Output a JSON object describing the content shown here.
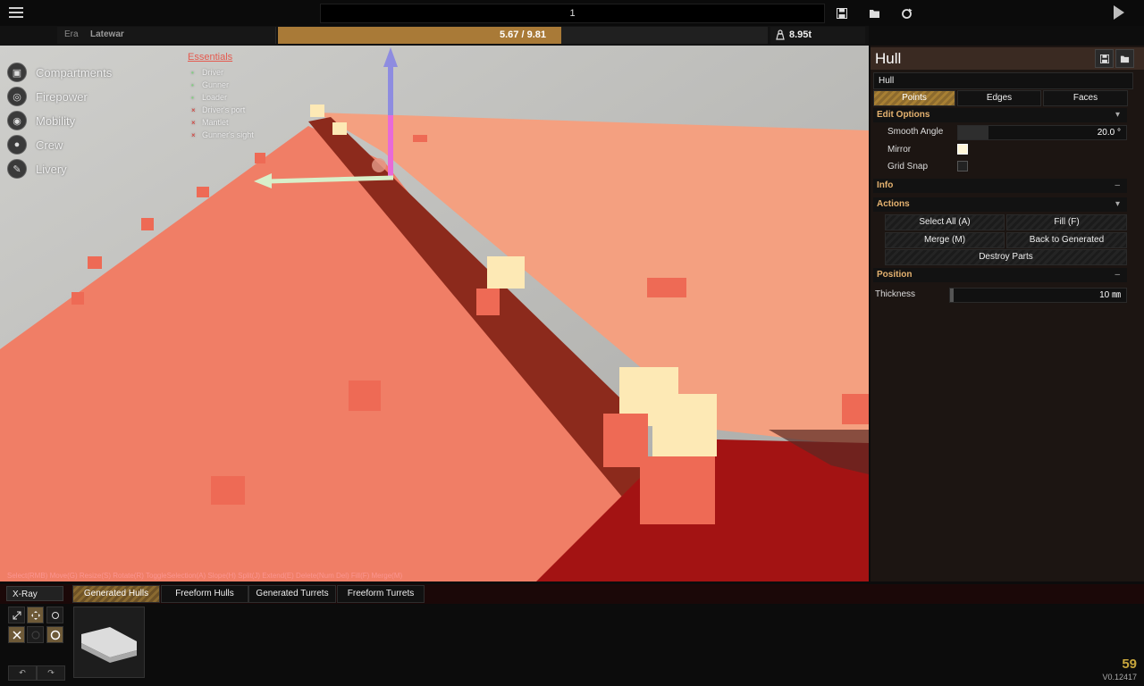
{
  "top": {
    "vehicle_name": "1",
    "save_icon": "save-icon",
    "load_icon": "folder-open-icon",
    "refresh_icon": "refresh-icon",
    "play_icon": "play-icon"
  },
  "stats": {
    "era_label": "Era",
    "era_value": "Latewar",
    "cost_text": "5.67 / 9.81",
    "cost_fraction": 0.578,
    "weight_text": "8.95t",
    "accent_color": "#a97a37"
  },
  "left_menu": [
    {
      "label": "Compartments",
      "icon": "cube-icon"
    },
    {
      "label": "Firepower",
      "icon": "target-icon"
    },
    {
      "label": "Mobility",
      "icon": "wheel-icon"
    },
    {
      "label": "Crew",
      "icon": "person-icon"
    },
    {
      "label": "Livery",
      "icon": "brush-icon"
    }
  ],
  "essentials": {
    "title": "Essentials",
    "items": [
      {
        "label": "Driver",
        "status": "ok",
        "mark": "•"
      },
      {
        "label": "Gunner",
        "status": "ok",
        "mark": "•"
      },
      {
        "label": "Loader",
        "status": "ok",
        "mark": "•"
      },
      {
        "label": "Driver's port",
        "status": "missing",
        "mark": "×"
      },
      {
        "label": "Mantlet",
        "status": "missing",
        "mark": "×"
      },
      {
        "label": "Gunner's sight",
        "status": "missing",
        "mark": "×"
      }
    ]
  },
  "shortcuts": "Select(RMB) Move(G) Resize(S) Rotate(R) ToggleSelection(A) Slope(H) Split(J) Extend(E) Delete(Num Del) Fill(F) Merge(M)",
  "panel": {
    "title": "Hull",
    "name_value": "Hull",
    "modes": [
      "Points",
      "Edges",
      "Faces"
    ],
    "active_mode": 0,
    "edit_options": {
      "title": "Edit Options",
      "smooth_angle_label": "Smooth Angle",
      "smooth_angle_value": "20.0 °",
      "smooth_angle_fraction": 0.18,
      "mirror_label": "Mirror",
      "mirror_on": true,
      "grid_snap_label": "Grid Snap",
      "grid_snap_on": false
    },
    "info_title": "Info",
    "actions": {
      "title": "Actions",
      "select_all": "Select All (A)",
      "fill": "Fill (F)",
      "merge": "Merge (M)",
      "back_to_generated": "Back to Generated",
      "destroy_parts": "Destroy Parts"
    },
    "position": {
      "title": "Position",
      "thickness_label": "Thickness",
      "thickness_value": "10 ㎜",
      "thickness_fraction": 0.02
    }
  },
  "bottom": {
    "xray": "X-Ray",
    "tabs": [
      "Generated Hulls",
      "Freeform Hulls",
      "Generated Turrets",
      "Freeform Turrets"
    ],
    "active_tab": 0,
    "tools": [
      "scale-icon",
      "move-icon",
      "rotate-icon",
      "mirror-icon",
      "center-icon",
      "reset-icon"
    ],
    "undo_icon": "undo-icon",
    "redo_icon": "redo-icon"
  },
  "fps": "59",
  "version": "V0.12417"
}
